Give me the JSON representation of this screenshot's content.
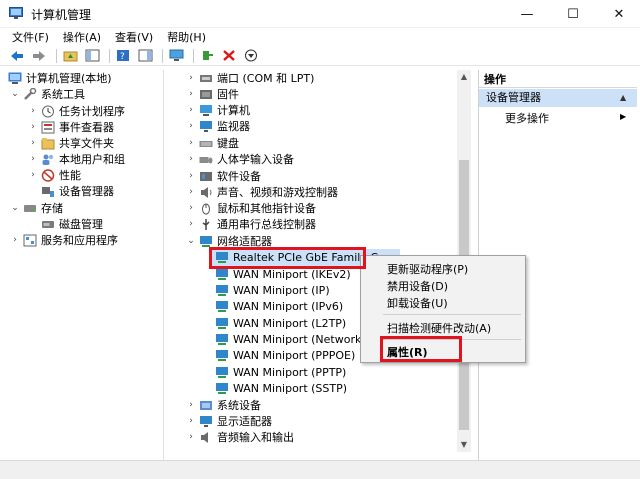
{
  "window": {
    "title": "计算机管理",
    "minimize_glyph": "—",
    "maximize_glyph": "☐",
    "close_glyph": "✕"
  },
  "menu": [
    "文件(F)",
    "操作(A)",
    "查看(V)",
    "帮助(H)"
  ],
  "left_tree": {
    "root": "计算机管理(本地)",
    "system_tools": "系统工具",
    "task_scheduler": "任务计划程序",
    "event_viewer": "事件查看器",
    "shared_folders": "共享文件夹",
    "local_users": "本地用户和组",
    "performance": "性能",
    "device_manager": "设备管理器",
    "storage": "存储",
    "disk_management": "磁盘管理",
    "services": "服务和应用程序"
  },
  "device_tree": {
    "ports": "端口 (COM 和 LPT)",
    "firmware": "固件",
    "computer": "计算机",
    "monitors": "监视器",
    "keyboards": "键盘",
    "hid": "人体学输入设备",
    "software_devices": "软件设备",
    "audio": "声音、视频和游戏控制器",
    "mice": "鼠标和其他指针设备",
    "usb": "通用串行总线控制器",
    "network_adapters": "网络适配器",
    "adapters": [
      "Realtek PCIe GbE Family Co",
      "WAN Miniport (IKEv2)",
      "WAN Miniport (IP)",
      "WAN Miniport (IPv6)",
      "WAN Miniport (L2TP)",
      "WAN Miniport (Network M",
      "WAN Miniport (PPPOE)",
      "WAN Miniport (PPTP)",
      "WAN Miniport (SSTP)"
    ],
    "system_devices": "系统设备",
    "display_adapters": "显示适配器",
    "audio_io": "音频输入和输出"
  },
  "actions": {
    "header": "操作",
    "section": "设备管理器",
    "more": "更多操作"
  },
  "context_menu": {
    "update_driver": "更新驱动程序(P)",
    "disable": "禁用设备(D)",
    "uninstall": "卸载设备(U)",
    "scan": "扫描检测硬件改动(A)",
    "properties": "属性(R)"
  },
  "colors": {
    "selection": "#cce1f7",
    "annotation_red": "#e0141e"
  }
}
